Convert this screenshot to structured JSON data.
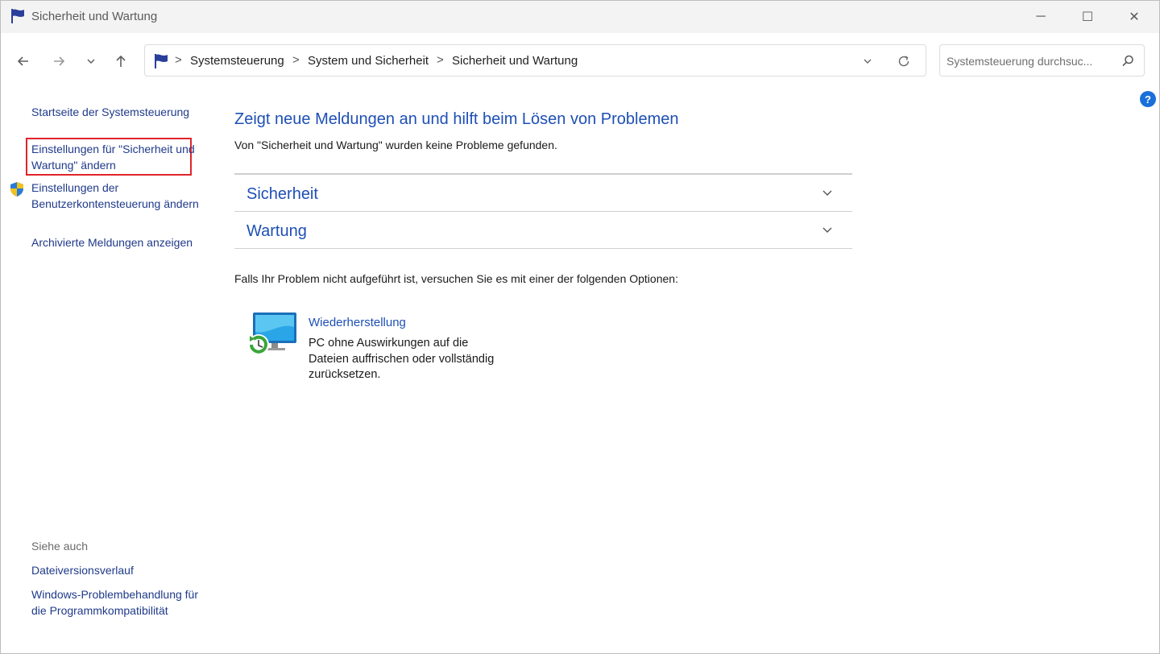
{
  "window": {
    "title": "Sicherheit und Wartung",
    "controls": {
      "minimize": "─",
      "maximize": "☐",
      "close": "✕"
    }
  },
  "navigation": {
    "back_icon": "arrow-left-icon",
    "forward_icon": "arrow-right-icon",
    "recent_icon": "chevron-down-icon",
    "up_icon": "arrow-up-icon",
    "breadcrumbs": [
      "Systemsteuerung",
      "System und Sicherheit",
      "Sicherheit und Wartung"
    ],
    "separator": ">",
    "search_placeholder": "Systemsteuerung durchsuc..."
  },
  "sidebar": {
    "links": [
      "Startseite der Systemsteuerung",
      "Einstellungen für \"Sicherheit und Wartung\" ändern",
      "Einstellungen der Benutzerkontensteuerung ändern",
      "Archivierte Meldungen anzeigen"
    ],
    "see_also_heading": "Siehe auch",
    "see_also": [
      "Dateiversionsverlauf",
      "Windows-Problembehandlung für die Programmkompatibilität"
    ],
    "highlight_color": "#e0242a"
  },
  "main": {
    "title": "Zeigt neue Meldungen an und hilft beim Lösen von Problemen",
    "status": "Von \"Sicherheit und Wartung\" wurden keine Probleme gefunden.",
    "sections": [
      "Sicherheit",
      "Wartung"
    ],
    "hint": "Falls Ihr Problem nicht aufgeführt ist, versuchen Sie es mit einer der folgenden Optionen:",
    "recovery": {
      "title": "Wiederherstellung",
      "description": "PC ohne Auswirkungen auf die Dateien auffrischen oder vollständig zurücksetzen."
    }
  },
  "help": "?",
  "colors": {
    "link": "#1f3a8a",
    "heading": "#1e4fb5",
    "accent": "#1a6fd9"
  }
}
